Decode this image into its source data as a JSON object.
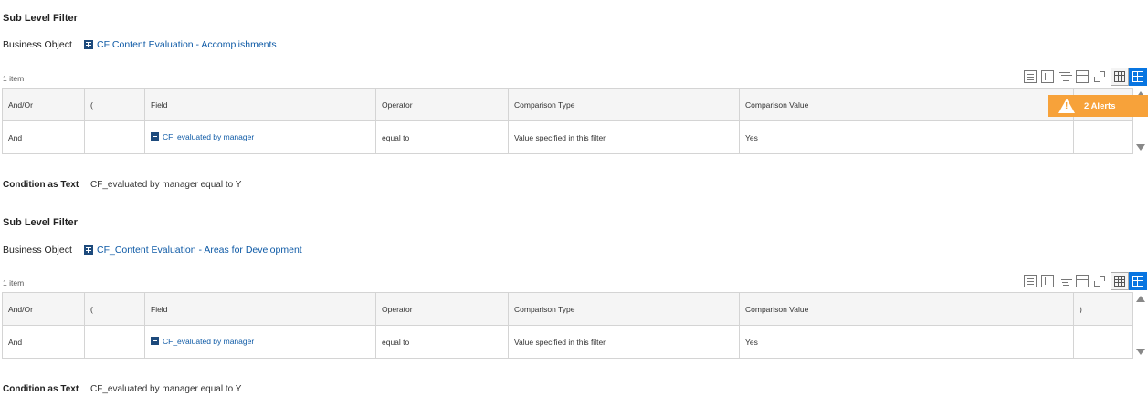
{
  "sections": [
    {
      "title": "Sub Level Filter",
      "business_object_label": "Business Object",
      "business_object_value": "CF Content Evaluation - Accomplishments",
      "item_count": "1 item",
      "columns": [
        "And/Or",
        "(",
        "Field",
        "Operator",
        "Comparison Type",
        "Comparison Value",
        ""
      ],
      "rows": [
        {
          "and_or": "And",
          "paren_open": "",
          "field": "CF_evaluated by manager",
          "operator": "equal to",
          "comparison_type": "Value specified in this filter",
          "comparison_value": "Yes",
          "paren_close": ""
        }
      ],
      "condition_label": "Condition as Text",
      "condition_value": "CF_evaluated by manager equal to Y"
    },
    {
      "title": "Sub Level Filter",
      "business_object_label": "Business Object",
      "business_object_value": "CF_Content Evaluation - Areas for Development",
      "item_count": "1 item",
      "columns": [
        "And/Or",
        "(",
        "Field",
        "Operator",
        "Comparison Type",
        "Comparison Value",
        ")"
      ],
      "rows": [
        {
          "and_or": "And",
          "paren_open": "",
          "field": "CF_evaluated by manager",
          "operator": "equal to",
          "comparison_type": "Value specified in this filter",
          "comparison_value": "Yes",
          "paren_close": ""
        }
      ],
      "condition_label": "Condition as Text",
      "condition_value": "CF_evaluated by manager equal to Y"
    }
  ],
  "alert": {
    "label": "2 Alerts"
  },
  "toolbar_icons": [
    "export-excel-icon",
    "export-pdf-icon",
    "filter-icon",
    "column-settings-icon",
    "fullscreen-icon",
    "table-view-icon",
    "grid-view-icon"
  ],
  "colors": {
    "link": "#0e5aa6",
    "accent": "#0875e1",
    "alert": "#f7a23a"
  }
}
